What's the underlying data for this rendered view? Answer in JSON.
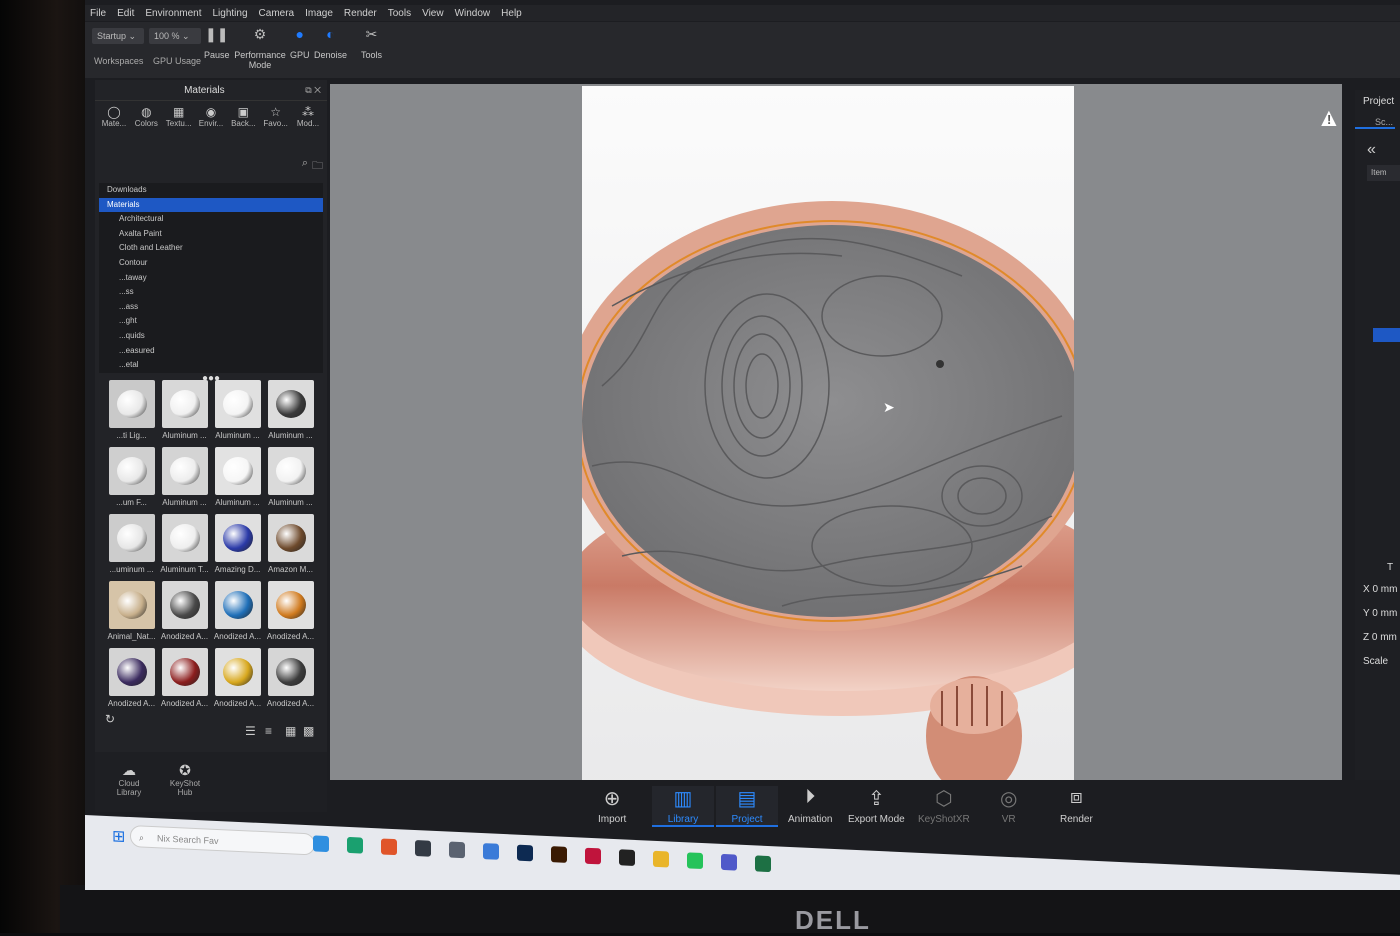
{
  "menu": [
    "File",
    "Edit",
    "Environment",
    "Lighting",
    "Camera",
    "Image",
    "Render",
    "Tools",
    "View",
    "Window",
    "Help"
  ],
  "toolbar": {
    "workspace_value": "Startup",
    "zoom_value": "100 %",
    "workspaces_label": "Workspaces",
    "gpu_usage_label": "GPU Usage",
    "pause_label": "Pause",
    "performance_mode_label": "Performance Mode",
    "gpu_label": "GPU",
    "denoise_label": "Denoise",
    "tools_label": "Tools"
  },
  "library": {
    "title": "Materials",
    "tabs": [
      "Mate...",
      "Colors",
      "Textu...",
      "Envir...",
      "Back...",
      "Favo...",
      "Mod..."
    ],
    "tree": [
      {
        "label": "Downloads",
        "level": 0,
        "selected": false
      },
      {
        "label": "Materials",
        "level": 0,
        "selected": true
      },
      {
        "label": "Architectural",
        "level": 1,
        "selected": false
      },
      {
        "label": "Axalta Paint",
        "level": 1,
        "selected": false
      },
      {
        "label": "Cloth and Leather",
        "level": 1,
        "selected": false
      },
      {
        "label": "Contour",
        "level": 1,
        "selected": false
      },
      {
        "label": "...taway",
        "level": 1,
        "selected": false
      },
      {
        "label": "...ss",
        "level": 1,
        "selected": false
      },
      {
        "label": "...ass",
        "level": 1,
        "selected": false
      },
      {
        "label": "...ght",
        "level": 1,
        "selected": false
      },
      {
        "label": "...quids",
        "level": 1,
        "selected": false
      },
      {
        "label": "...easured",
        "level": 1,
        "selected": false
      },
      {
        "label": "...etal",
        "level": 1,
        "selected": false
      }
    ],
    "thumbnails": [
      {
        "name": "...ti Lig...",
        "color": "#c9c9c9",
        "ball": "#e8e8e8"
      },
      {
        "name": "Aluminum ...",
        "color": "#d8d8d8",
        "ball": "#f0f0f0"
      },
      {
        "name": "Aluminum ...",
        "color": "#e0e0e0",
        "ball": "#f4f4f4"
      },
      {
        "name": "Aluminum ...",
        "color": "#dcdcdc",
        "ball": "#3a3a3a"
      },
      {
        "name": "...um F...",
        "color": "#cfcfcf",
        "ball": "#e8e8e8"
      },
      {
        "name": "Aluminum ...",
        "color": "#d4d4d4",
        "ball": "#ededed"
      },
      {
        "name": "Aluminum ...",
        "color": "#e2e2e2",
        "ball": "#f6f6f6"
      },
      {
        "name": "Aluminum ...",
        "color": "#dadada",
        "ball": "#f2f2f2"
      },
      {
        "name": "...uminum ...",
        "color": "#cccccc",
        "ball": "#e6e6e6"
      },
      {
        "name": "Aluminum T...",
        "color": "#d6d6d6",
        "ball": "#eeeeee"
      },
      {
        "name": "Amazing D...",
        "color": "#e0e0e0",
        "ball": "#2b3aa8"
      },
      {
        "name": "Amazon M...",
        "color": "#dadada",
        "ball": "#6e4a2c"
      },
      {
        "name": "Animal_Nat...",
        "color": "#d6c4a8",
        "ball": "#c8b08c"
      },
      {
        "name": "Anodized A...",
        "color": "#d8d8d8",
        "ball": "#4a4a4a"
      },
      {
        "name": "Anodized A...",
        "color": "#dcdcdc",
        "ball": "#1f6fb8"
      },
      {
        "name": "Anodized A...",
        "color": "#e0e0e0",
        "ball": "#d07a1e"
      },
      {
        "name": "Anodized A...",
        "color": "#d4d4d4",
        "ball": "#3a2a5e"
      },
      {
        "name": "Anodized A...",
        "color": "#dadada",
        "ball": "#8c1e1e"
      },
      {
        "name": "Anodized A...",
        "color": "#e0e0e0",
        "ball": "#d8a81e"
      },
      {
        "name": "Anodized A...",
        "color": "#d6d6d6",
        "ball": "#3c3c3c"
      }
    ],
    "cloud_library_label": "Cloud Library",
    "keyshot_hub_label": "KeyShot Hub"
  },
  "project_panel": {
    "title": "Project",
    "tab": "Sc...",
    "items_header": "Item",
    "x_label": "X",
    "x_value": "0 mm",
    "y_label": "Y",
    "y_value": "0 mm",
    "z_label": "Z",
    "z_value": "0 mm",
    "scale_label": "Scale",
    "t_label": "T"
  },
  "ribbon": [
    {
      "label": "Import",
      "icon": "import-icon",
      "state": "normal"
    },
    {
      "label": "Library",
      "icon": "book-icon",
      "state": "active"
    },
    {
      "label": "Project",
      "icon": "list-icon",
      "state": "active"
    },
    {
      "label": "Animation",
      "icon": "play-circle-icon",
      "state": "normal"
    },
    {
      "label": "Export Mode",
      "icon": "export-icon",
      "state": "normal"
    },
    {
      "label": "KeyShotXR",
      "icon": "cube-icon",
      "state": "dim"
    },
    {
      "label": "VR",
      "icon": "vr-icon",
      "state": "dim"
    },
    {
      "label": "Render",
      "icon": "render-icon",
      "state": "normal"
    }
  ],
  "taskbar": {
    "search_placeholder": "Nix Search Fav",
    "apps": [
      {
        "name": "copilot-icon",
        "color": "#2f8fe0"
      },
      {
        "name": "edge-icon",
        "color": "#1aa06f"
      },
      {
        "name": "app-orange-icon",
        "color": "#e0552a"
      },
      {
        "name": "app-dark-icon",
        "color": "#333a44"
      },
      {
        "name": "app-gray-icon",
        "color": "#5a6270"
      },
      {
        "name": "app-blue-icon",
        "color": "#3b7bd8"
      },
      {
        "name": "photoshop-icon",
        "color": "#0d2a52"
      },
      {
        "name": "illustrator-icon",
        "color": "#3a1a02"
      },
      {
        "name": "app-red-icon",
        "color": "#c0143c"
      },
      {
        "name": "app-black-icon",
        "color": "#222222"
      },
      {
        "name": "explorer-icon",
        "color": "#e9b52a"
      },
      {
        "name": "whatsapp-icon",
        "color": "#25c35a"
      },
      {
        "name": "teams-icon",
        "color": "#5059c9"
      },
      {
        "name": "excel-icon",
        "color": "#1d7044"
      }
    ]
  },
  "monitor_brand": "DELL"
}
